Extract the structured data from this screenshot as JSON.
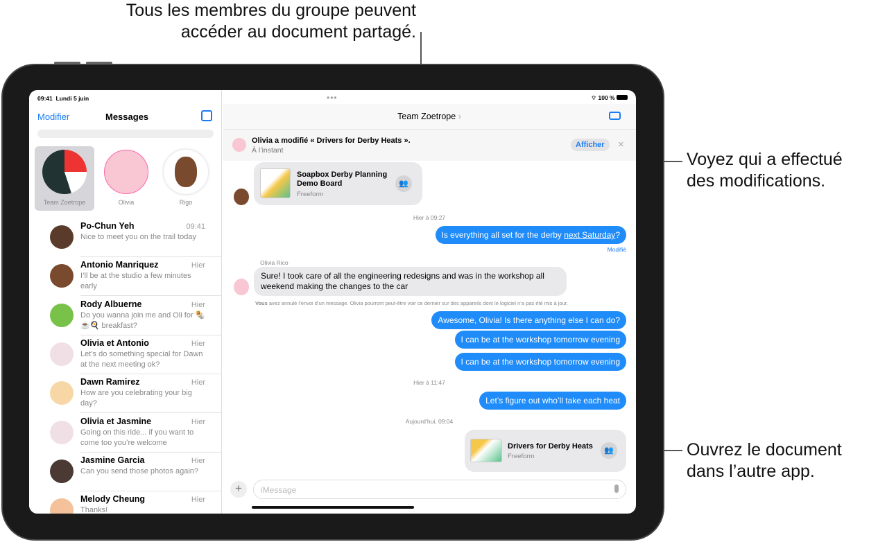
{
  "callouts": {
    "top": [
      "Tous les membres du groupe peuvent",
      "accéder au document partagé."
    ],
    "right1": [
      "Voyez qui a effectué",
      "des modifications."
    ],
    "right2": [
      "Ouvrez le document",
      "dans l’autre app."
    ]
  },
  "status": {
    "time": "09:41",
    "date": "Lundi 5 juin",
    "battery": "100 %"
  },
  "sidebar": {
    "edit": "Modifier",
    "title": "Messages",
    "compose_icon": "compose-icon",
    "pinned": [
      {
        "label": "Team Zoetrope"
      },
      {
        "label": "Olivia"
      },
      {
        "label": "Rigo"
      }
    ],
    "conversations": [
      {
        "name": "Po-Chun Yeh",
        "time": "09:41",
        "preview": "Nice to meet you on the trail today"
      },
      {
        "name": "Antonio Manriquez",
        "time": "Hier",
        "preview": "I’ll be at the studio a few minutes early"
      },
      {
        "name": "Rody Albuerne",
        "time": "Hier",
        "preview": "Do you wanna join me and Oli for 🌯☕🍳 breakfast?"
      },
      {
        "name": "Olivia et Antonio",
        "time": "Hier",
        "preview": "Let’s do something special for Dawn at the next meeting ok?"
      },
      {
        "name": "Dawn Ramirez",
        "time": "Hier",
        "preview": "How are you celebrating your big day?"
      },
      {
        "name": "Olivia et Jasmine",
        "time": "Hier",
        "preview": "Going on this ride... if you want to come too you’re welcome"
      },
      {
        "name": "Jasmine Garcia",
        "time": "Hier",
        "preview": "Can you send those photos again?"
      },
      {
        "name": "Melody Cheung",
        "time": "Hier",
        "preview": "Thanks!"
      }
    ]
  },
  "chat": {
    "title": "Team Zoetrope",
    "chevron": "›",
    "banner": {
      "text": "Olivia a modifié « Drivers for Derby Heats ».",
      "time": "À l’instant",
      "button": "Afficher"
    },
    "card1": {
      "title": "Soapbox Derby Planning Demo Board",
      "app": "Freeform"
    },
    "ts1": "Hier à 09:27",
    "msg1": {
      "pre": "Is everything all set for the derby ",
      "link": "next Saturday",
      "post": "?"
    },
    "edited": "Modifié",
    "sender": "Olivia Rico",
    "msg2": "Sure! I took care of all the engineering redesigns and was in the workshop all weekend making the changes to the car",
    "note_bold": "Vous",
    "note": " avez annulé l’envoi d’un message. Olivia pourront peut-être voir ce dernier sur des appareils dont le logiciel n’a pas été mis à jour.",
    "msg3": "Awesome, Olivia! Is there anything else I can do?",
    "msg4": "I can be at the workshop tomorrow evening",
    "msg5": "I can be at the workshop tomorrow evening",
    "ts2": "Hier à 11:47",
    "msg6": "Let’s figure out who’ll take each heat",
    "ts3": "Aujourd’hui, 09:04",
    "card2": {
      "title": "Drivers for Derby Heats",
      "app": "Freeform"
    },
    "input_placeholder": "iMessage"
  }
}
